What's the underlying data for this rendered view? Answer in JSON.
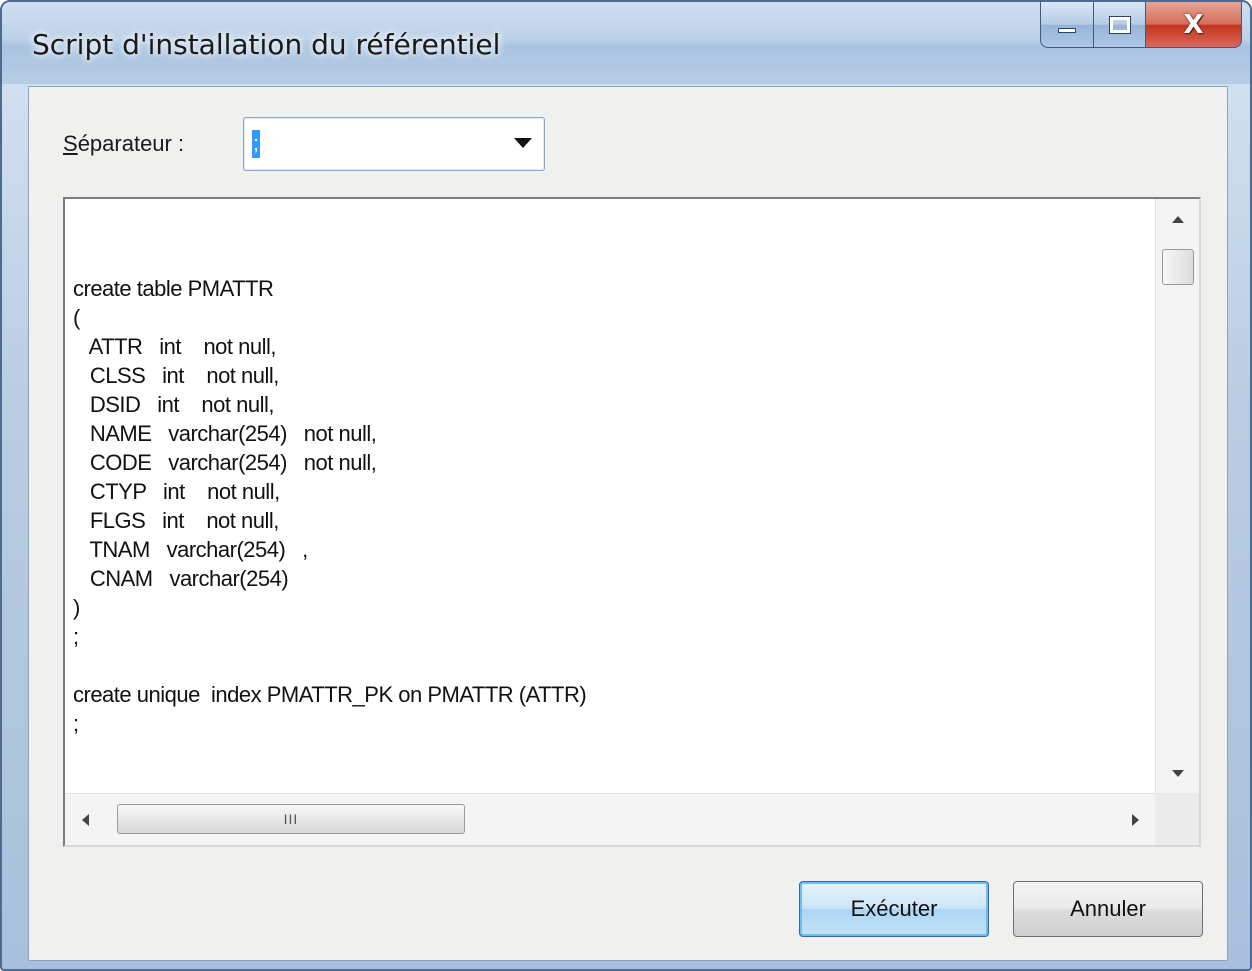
{
  "window": {
    "title": "Script d'installation du référentiel",
    "minimize_icon": "minimize-icon",
    "maximize_icon": "maximize-icon",
    "close_glyph": "X"
  },
  "separator": {
    "label_underlined": "S",
    "label_rest": "éparateur :",
    "value": ";"
  },
  "script_lines": [
    "",
    "create table PMATTR",
    "(",
    "   ATTR   int    not null,",
    "   CLSS   int    not null,",
    "   DSID   int    not null,",
    "   NAME   varchar(254)   not null,",
    "   CODE   varchar(254)   not null,",
    "   CTYP   int    not null,",
    "   FLGS   int    not null,",
    "   TNAM   varchar(254)   ,",
    "   CNAM   varchar(254)",
    ")",
    ";",
    "",
    "create unique  index PMATTR_PK on PMATTR (ATTR)",
    ";"
  ],
  "hscroll_thumb_grip": "III",
  "buttons": {
    "execute": "Exécuter",
    "cancel": "Annuler"
  }
}
